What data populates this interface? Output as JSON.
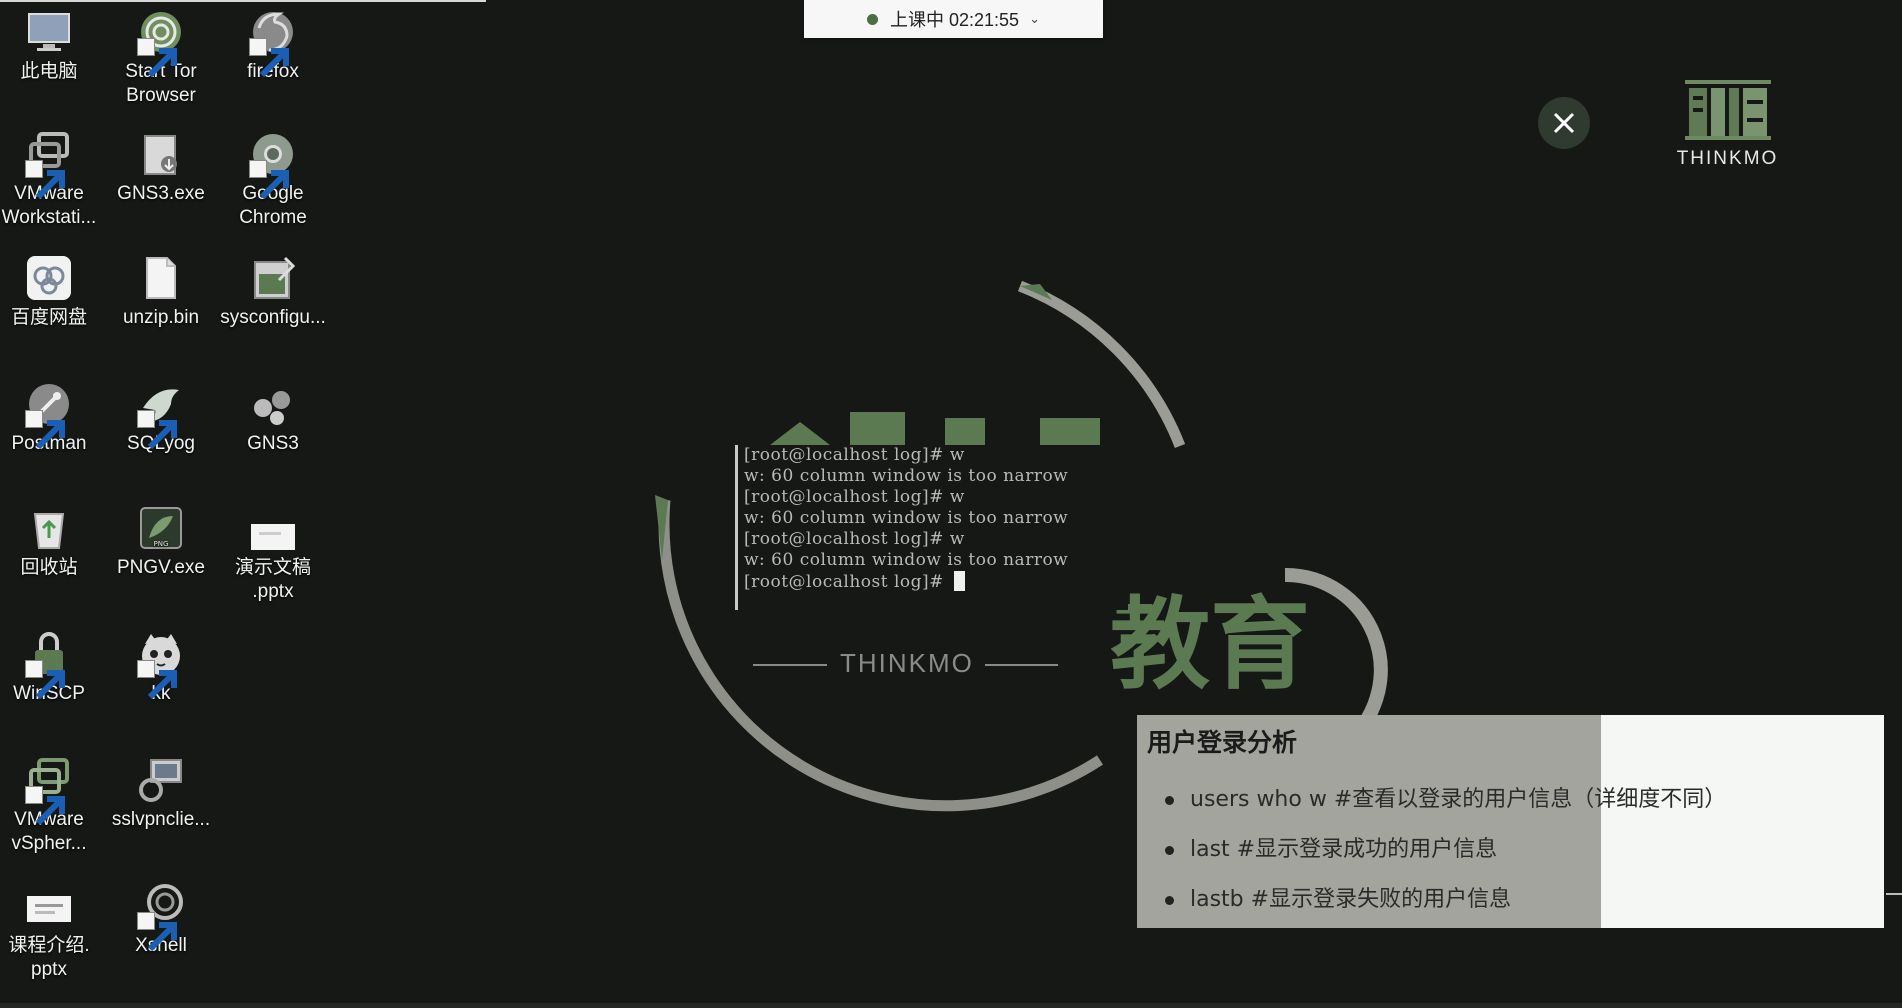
{
  "status_bar": {
    "label": "上课中 02:21:55"
  },
  "desktop": {
    "icons": [
      {
        "label": "此电脑",
        "icon": "computer-icon"
      },
      {
        "label": "Start Tor Browser",
        "icon": "tor-onion-icon"
      },
      {
        "label": "firefox",
        "icon": "firefox-icon"
      },
      {
        "label": "VMware Workstati...",
        "icon": "vmware-workstation-icon"
      },
      {
        "label": "GNS3.exe",
        "icon": "installer-icon"
      },
      {
        "label": "Google Chrome",
        "icon": "chrome-icon"
      },
      {
        "label": "百度网盘",
        "icon": "baidu-netdisk-icon"
      },
      {
        "label": "unzip.bin",
        "icon": "file-icon"
      },
      {
        "label": "sysconfigu...",
        "icon": "script-icon"
      },
      {
        "label": "Postman",
        "icon": "postman-icon"
      },
      {
        "label": "SQLyog",
        "icon": "dolphin-icon"
      },
      {
        "label": "GNS3",
        "icon": "gns3-icon"
      },
      {
        "label": "回收站",
        "icon": "recycle-bin-icon"
      },
      {
        "label": "PNGV.exe",
        "icon": "png-viewer-icon"
      },
      {
        "label": "演示文稿 .pptx",
        "icon": "pptx-file-icon"
      },
      {
        "label": "WinSCP",
        "icon": "winscp-icon"
      },
      {
        "label": "kk",
        "icon": "cat-face-icon"
      },
      {
        "label": "VMware vSpher...",
        "icon": "vsphere-icon"
      },
      {
        "label": "sslvpnclie...",
        "icon": "vpn-client-icon"
      },
      {
        "label": "课程介绍. pptx",
        "icon": "pptx-file-icon"
      },
      {
        "label": "Xshell",
        "icon": "xshell-icon"
      }
    ]
  },
  "logo": {
    "wordmark": "THINKMO"
  },
  "slide": {
    "brand_en": "THINKMO",
    "brand_cn": "教育",
    "title": "用户登录分析",
    "bullets": [
      "users  who  w   #查看以登录的用户信息（详细度不同）",
      "last   #显示登录成功的用户信息",
      "lastb #显示登录失败的用户信息"
    ]
  },
  "terminal": {
    "lines": [
      "[root@localhost log]# w",
      "w: 60 column window is too narrow",
      "[root@localhost log]# w",
      "w: 60 column window is too narrow",
      "[root@localhost log]# w",
      "w: 60 column window is too narrow",
      "[root@localhost log]# "
    ]
  },
  "colors": {
    "background": "#151815",
    "accent_green": "#5c7a52",
    "panel_gray": "#a4a49f",
    "panel_white": "#f5f7f4"
  }
}
